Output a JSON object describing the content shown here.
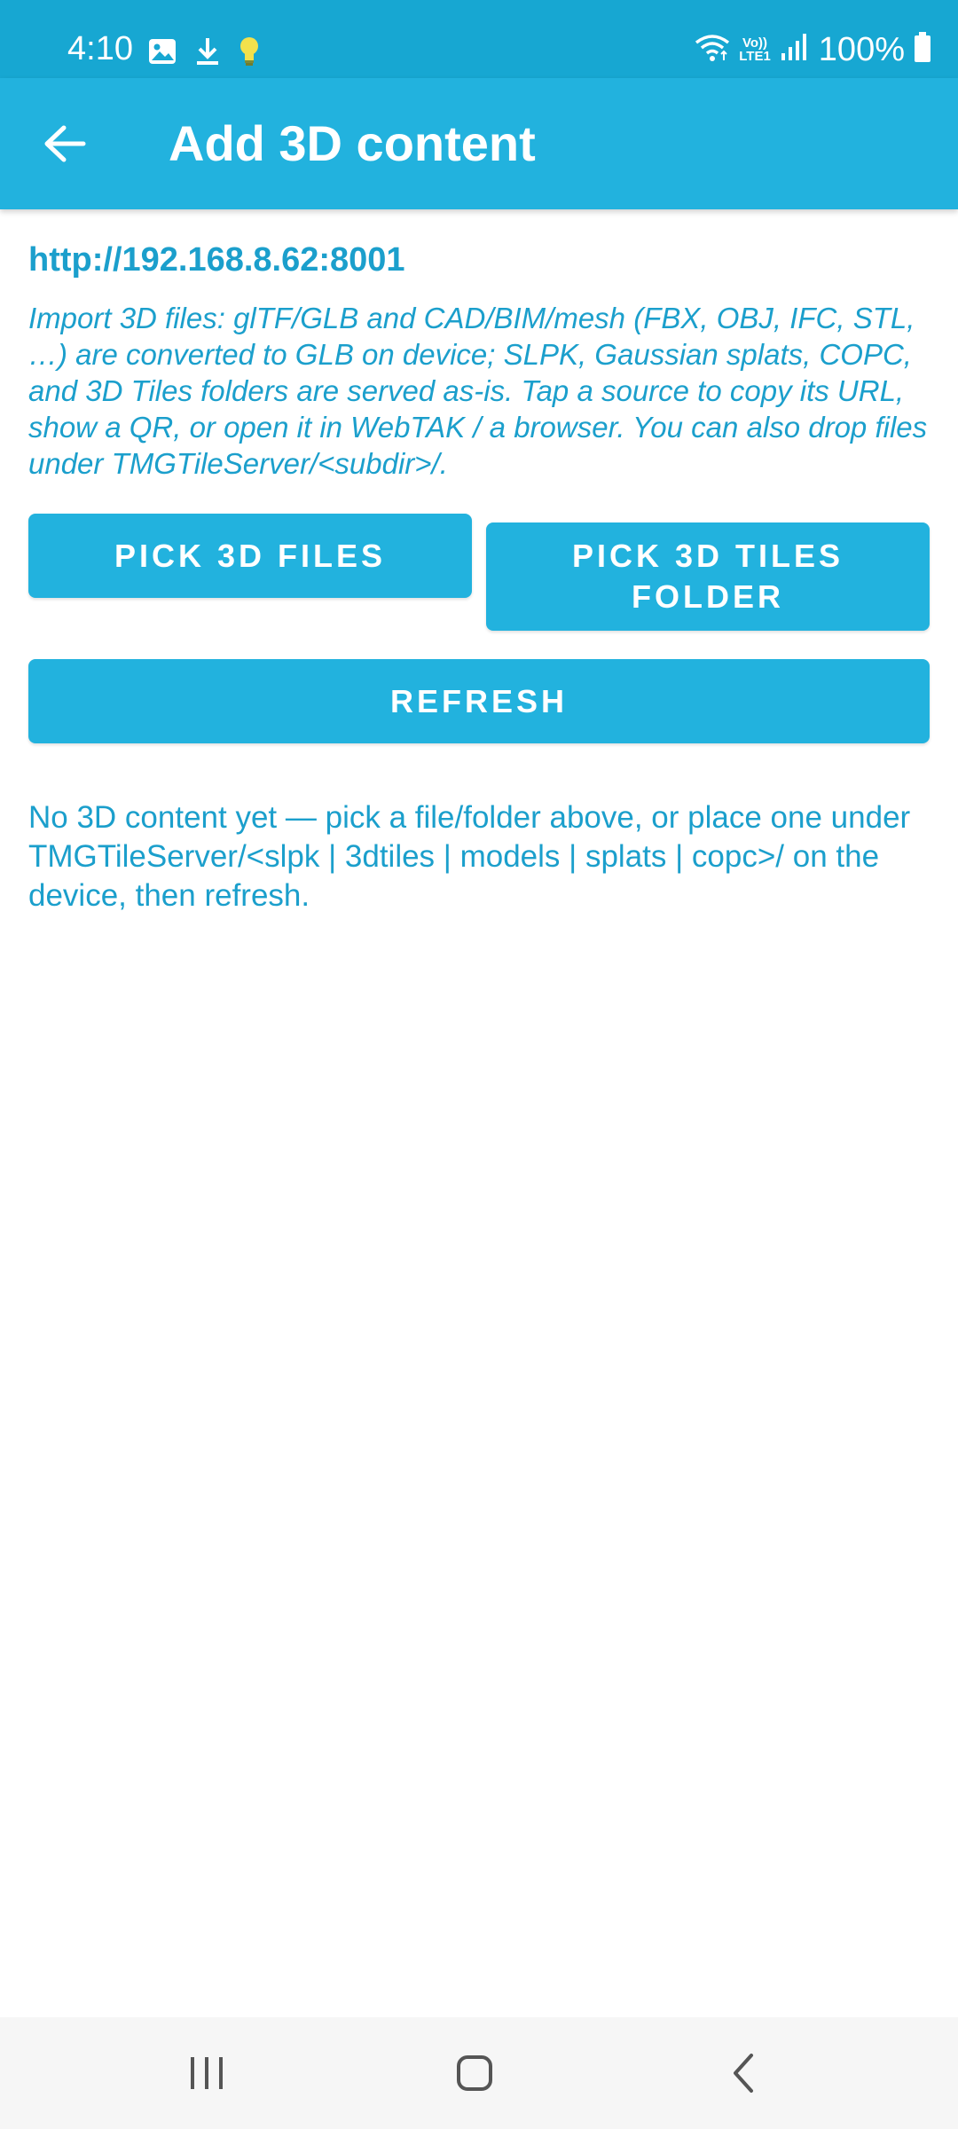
{
  "status_bar": {
    "time": "4:10",
    "battery": "100%",
    "volte_line1": "Vo))",
    "volte_line2": "LTE1",
    "icons_left": [
      "image-icon",
      "download-icon",
      "lightbulb-icon"
    ],
    "icons_right": [
      "wifi-icon",
      "volte-icon",
      "signal-icon",
      "battery-icon"
    ]
  },
  "app_bar": {
    "title": "Add 3D content",
    "back_icon": "arrow-left-icon"
  },
  "content": {
    "server_url": "http://192.168.8.62:8001",
    "description": "Import 3D files: glTF/GLB and CAD/BIM/mesh (FBX, OBJ, IFC, STL, …) are converted to GLB on device; SLPK, Gaussian splats, COPC, and 3D Tiles folders are served as-is. Tap a source to copy its URL, show a QR, or open it in WebTAK / a browser. You can also drop files under TMGTileServer/<subdir>/.",
    "empty_message": "No 3D content yet — pick a file/folder above, or place one under TMGTileServer/<slpk | 3dtiles | models | splats | copc>/ on the device, then refresh."
  },
  "buttons": {
    "pick_files": "PICK 3D FILES",
    "pick_tiles_line1": "PICK 3D TILES",
    "pick_tiles_line2": "FOLDER",
    "refresh": "REFRESH"
  },
  "nav_bar": {
    "icons": [
      "recents-icon",
      "home-icon",
      "back-icon"
    ]
  },
  "colors": {
    "status_bar": "#17a7d2",
    "app_bar": "#22b2de",
    "accent_text": "#1b9fcc",
    "button": "#22b2de"
  }
}
